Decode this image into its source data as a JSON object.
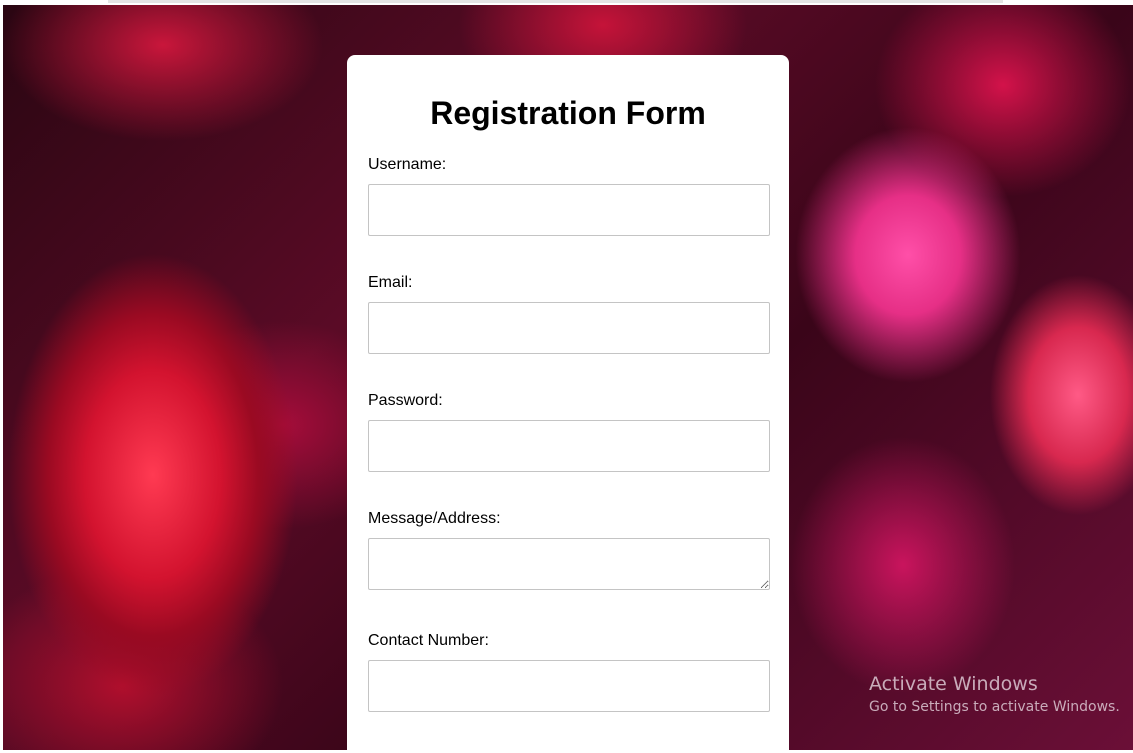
{
  "form": {
    "title": "Registration Form",
    "fields": {
      "username": {
        "label": "Username:",
        "value": ""
      },
      "email": {
        "label": "Email:",
        "value": ""
      },
      "password": {
        "label": "Password:",
        "value": ""
      },
      "message": {
        "label": "Message/Address:",
        "value": ""
      },
      "contact": {
        "label": "Contact Number:",
        "value": ""
      }
    },
    "submit_color": "#4caf50"
  },
  "background": {
    "accent_colors": [
      "#d3132f",
      "#e62f86",
      "#5a0b26"
    ]
  },
  "watermark": {
    "title": "Activate Windows",
    "subtitle": "Go to Settings to activate Windows."
  }
}
